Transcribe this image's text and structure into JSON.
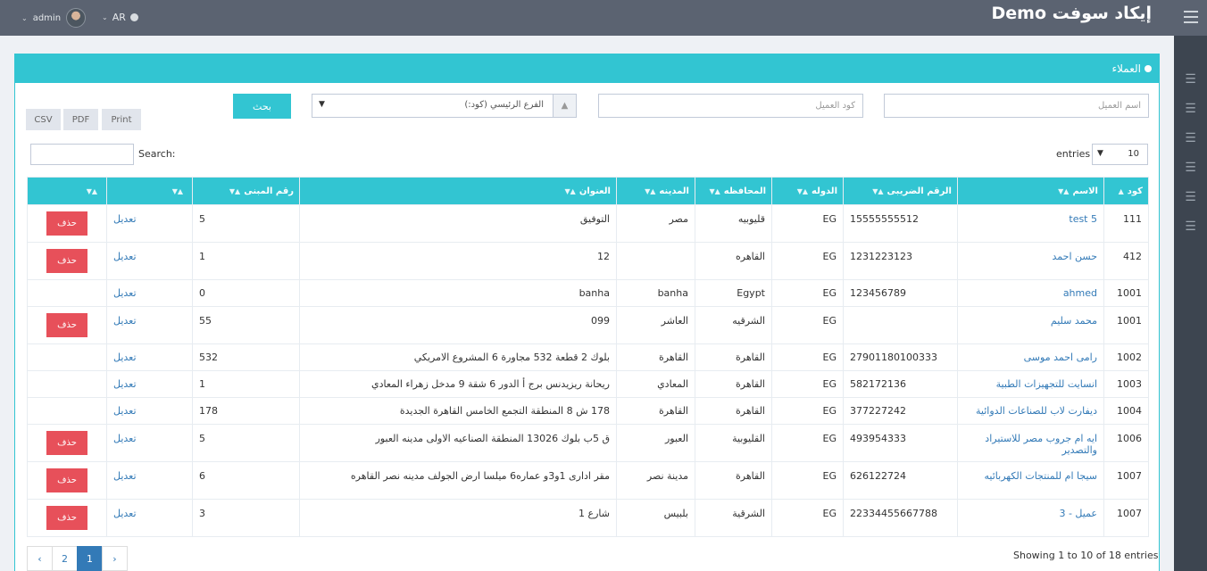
{
  "header": {
    "brand": "إيكاد سوفت Demo",
    "lang": "AR",
    "user": "admin"
  },
  "sidebar_icons": [
    "layers-icon",
    "layers-icon",
    "layers-icon",
    "layers-icon",
    "layers-icon",
    "layers-icon"
  ],
  "portlet": {
    "title": "العملاء"
  },
  "filters": {
    "name_placeholder": "اسم العميل",
    "code_placeholder": "كود العميل",
    "branch_value": "الفرع الرئيسي (كود:)",
    "search_button": "بحث"
  },
  "tools": {
    "print": "Print",
    "pdf": "PDF",
    "csv": "CSV"
  },
  "datatable": {
    "search_label": "Search:",
    "entries_label": "entries",
    "length_value": "10",
    "showing": "Showing 1 to 10 of 18 entries"
  },
  "columns": {
    "code": "كود",
    "name": "الاسم",
    "tax": "الرقم الضريبى",
    "country": "الدوله",
    "gov": "المحافظه",
    "city": "المدينه",
    "address": "العنوان",
    "building": "رقم المبنى",
    "edit": "",
    "del": ""
  },
  "labels": {
    "edit": "تعديل",
    "delete": "حذف"
  },
  "rows": [
    {
      "code": "111",
      "name": "test 5",
      "tax": "15555555512",
      "country": "EG",
      "gov": "قليوبيه",
      "city": "مصر",
      "address": "التوفيق",
      "building": "5",
      "edit": "تعديل",
      "delete": "حذف"
    },
    {
      "code": "412",
      "name": "حسن احمد",
      "tax": "1231223123",
      "country": "EG",
      "gov": "القاهره",
      "city": "",
      "address": "12",
      "building": "1",
      "edit": "تعديل",
      "delete": "حذف"
    },
    {
      "code": "1001",
      "name": "ahmed",
      "tax": "123456789",
      "country": "EG",
      "gov": "Egypt",
      "city": "banha",
      "address": "banha",
      "building": "0",
      "edit": "تعديل",
      "delete": ""
    },
    {
      "code": "1001",
      "name": "محمد سليم",
      "tax": "",
      "country": "EG",
      "gov": "الشرقيه",
      "city": "العاشر",
      "address": "099",
      "building": "55",
      "edit": "تعديل",
      "delete": "حذف"
    },
    {
      "code": "1002",
      "name": "رامى احمد موسى",
      "tax": "27901180100333",
      "country": "EG",
      "gov": "القاهرة",
      "city": "القاهرة",
      "address": "بلوك 2 قطعة 532 مجاورة 6 المشروع الامريكي",
      "building": "532",
      "edit": "تعديل",
      "delete": ""
    },
    {
      "code": "1003",
      "name": "انسايت للتجهيزات الطبية",
      "tax": "582172136",
      "country": "EG",
      "gov": "القاهرة",
      "city": "المعادي",
      "address": "ريحانة ريزيدنس برج أ الدور 6 شقة 9 مدخل زهراء المعادي",
      "building": "1",
      "edit": "تعديل",
      "delete": ""
    },
    {
      "code": "1004",
      "name": "ديفارت لاب للصناعات الدوائية",
      "tax": "377227242",
      "country": "EG",
      "gov": "القاهرة",
      "city": "القاهرة",
      "address": "178 ش 8 المنطقة التجمع الخامس القاهرة الجديدة",
      "building": "178",
      "edit": "تعديل",
      "delete": ""
    },
    {
      "code": "1006",
      "name": "ايه ام جروب مصر للاستيراد والتصدير",
      "tax": "493954333",
      "country": "EG",
      "gov": "القليوبية",
      "city": "العبور",
      "address": "ق 5ب بلوك 13026 المنطقة الصناعيه الاولى مدينه العبور",
      "building": "5",
      "edit": "تعديل",
      "delete": "حذف"
    },
    {
      "code": "1007",
      "name": "سيجا ام للمنتجات الكهربائيه",
      "tax": "626122724",
      "country": "EG",
      "gov": "القاهرة",
      "city": "مدينة نصر",
      "address": "مقر ادارى 1و3و عماره6 ميلسا ارض الجولف مدينه نصر القاهره",
      "building": "6",
      "edit": "تعديل",
      "delete": "حذف"
    },
    {
      "code": "1007",
      "name": "عميل - 3",
      "tax": "22334455667788",
      "country": "EG",
      "gov": "الشرقية",
      "city": "بلبيس",
      "address": "شارع 1",
      "building": "3",
      "edit": "تعديل",
      "delete": "حذف"
    }
  ],
  "pagination": {
    "prev": "‹",
    "pages": [
      "1",
      "2"
    ],
    "next": "›",
    "active": "1"
  },
  "colors": {
    "accent": "#32c5d2",
    "danger": "#e7505a",
    "topbar": "#5b6371",
    "sidebar": "#3d4550",
    "link": "#337ab7"
  }
}
